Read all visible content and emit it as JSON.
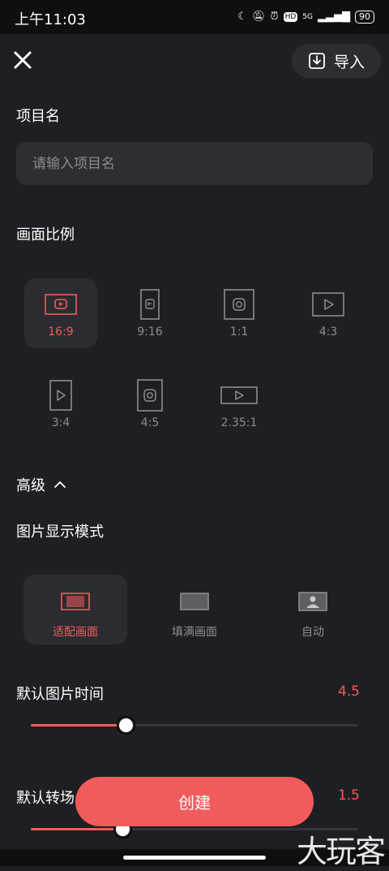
{
  "status_bar": {
    "time": "上午11:03",
    "network": "5G",
    "hd": "HD",
    "battery": "90"
  },
  "header": {
    "import_label": "导入"
  },
  "project_name": {
    "label": "项目名",
    "placeholder": "请输入项目名",
    "value": ""
  },
  "aspect_ratio": {
    "label": "画面比例",
    "options": [
      {
        "label": "16:9",
        "icon": "youtube-landscape-icon",
        "selected": true
      },
      {
        "label": "9:16",
        "icon": "tiktok-portrait-icon",
        "selected": false
      },
      {
        "label": "1:1",
        "icon": "instagram-square-icon",
        "selected": false
      },
      {
        "label": "4:3",
        "icon": "play-landscape-icon",
        "selected": false
      },
      {
        "label": "3:4",
        "icon": "play-portrait-icon",
        "selected": false
      },
      {
        "label": "4:5",
        "icon": "instagram-portrait-icon",
        "selected": false
      },
      {
        "label": "2.35:1",
        "icon": "play-widescreen-icon",
        "selected": false
      }
    ]
  },
  "advanced": {
    "label": "高级",
    "expanded": true
  },
  "display_mode": {
    "label": "图片显示模式",
    "options": [
      {
        "label": "适配画面",
        "icon": "fit-image-icon",
        "selected": true
      },
      {
        "label": "填满画面",
        "icon": "fill-image-icon",
        "selected": false
      },
      {
        "label": "自动",
        "icon": "auto-image-icon",
        "selected": false
      }
    ]
  },
  "default_image_time": {
    "label": "默认图片时间",
    "value": "4.5",
    "fraction": 0.29
  },
  "default_transition": {
    "label": "默认转场",
    "value": "1.5",
    "fraction": 0.28
  },
  "create_button": {
    "label": "创建"
  },
  "watermark": "大玩客",
  "colors": {
    "accent": "#f25b5b",
    "background": "#1e1f22",
    "surface": "#2d2e33",
    "muted": "#8c8d92"
  }
}
